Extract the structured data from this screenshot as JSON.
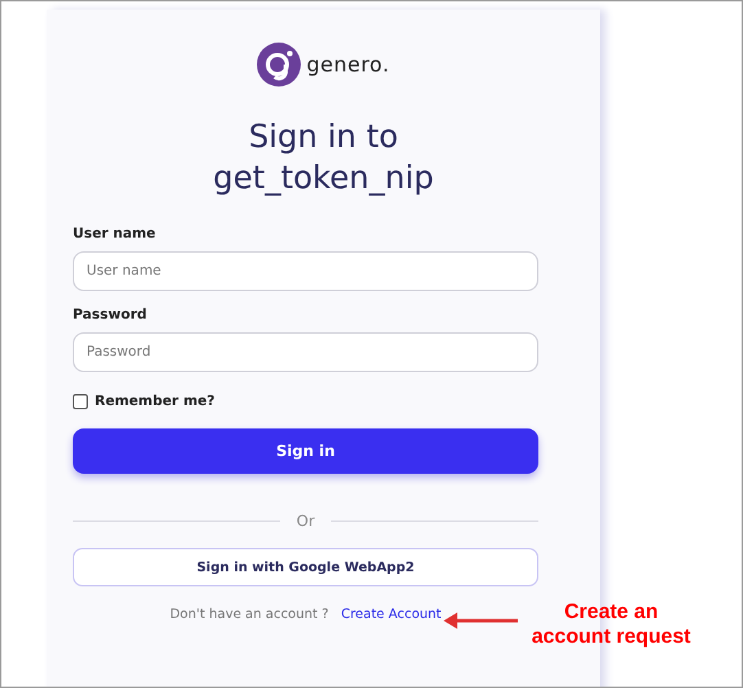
{
  "logo": {
    "text": "genero."
  },
  "title": [
    "Sign in to",
    "get_token_nip"
  ],
  "fields": [
    {
      "label": "User name",
      "placeholder": "User name"
    },
    {
      "label": "Password",
      "placeholder": "Password"
    }
  ],
  "remember": {
    "label": "Remember me?",
    "checked": false
  },
  "sign_in_button": "Sign in",
  "divider": "Or",
  "google_button": "Sign in with Google WebApp2",
  "footer": {
    "text": "Don't have an account ?",
    "link": "Create Account"
  },
  "annotation": {
    "lines": [
      "Create an",
      "account request"
    ]
  }
}
